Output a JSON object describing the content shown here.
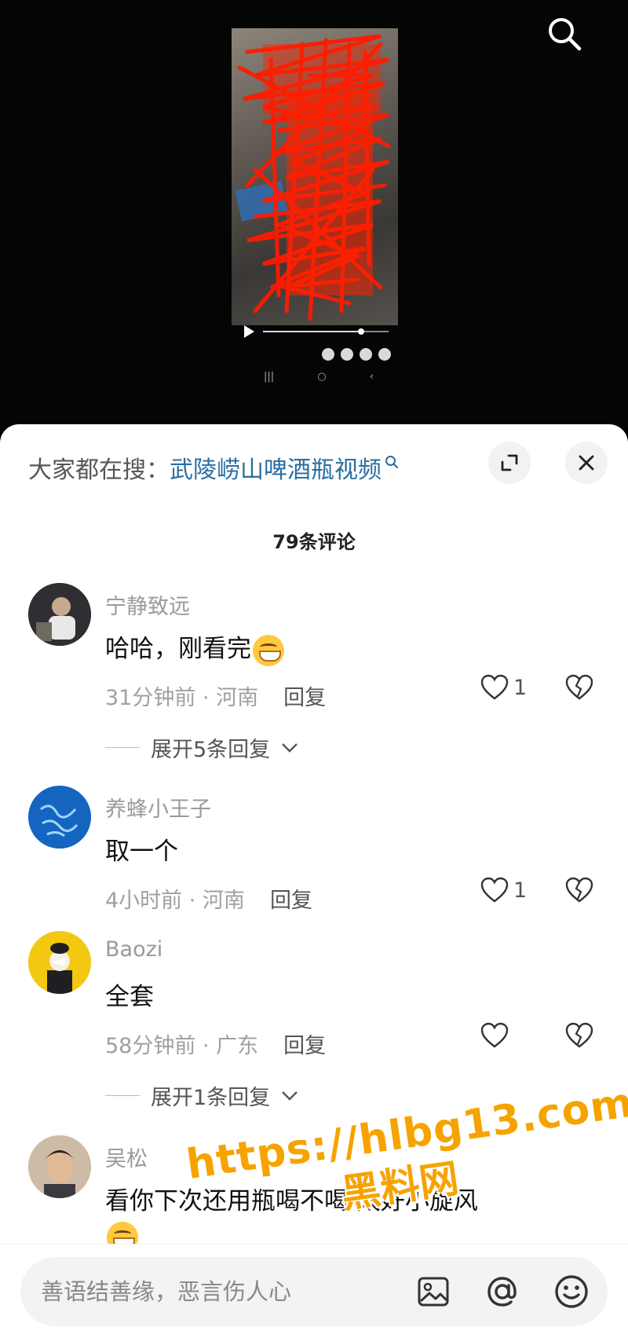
{
  "video": {
    "play_label": "",
    "timecode": "",
    "progress": 0.78
  },
  "search_suggest": {
    "prefix": "大家都在搜：",
    "topic": "武陵崂山啤酒瓶视频"
  },
  "comments_header": {
    "count_label": "79条评论"
  },
  "comments": [
    {
      "author": "宁静致远",
      "text": "哈哈，刚看完",
      "time_location": "31分钟前 · 河南",
      "reply_label": "回复",
      "likes": "1",
      "expand_label": "展开5条回复",
      "avatar_color": "#3b3a3f"
    },
    {
      "author": "养蜂小王子",
      "text": "取一个",
      "time_location": "4小时前 · 河南",
      "reply_label": "回复",
      "likes": "1",
      "avatar_color": "#1565c0"
    },
    {
      "author": "Baozi",
      "text": "全套",
      "time_location": "58分钟前 · 广东",
      "reply_label": "回复",
      "likes": "",
      "expand_label": "展开1条回复",
      "avatar_color": "#f2c811"
    },
    {
      "author": "吴松",
      "text": "看你下次还用瓶喝不喝 太好小旋风",
      "avatar_color": "#d9c4ae"
    }
  ],
  "watermark": {
    "url": "https://hlbg13.com",
    "name": "黑料网"
  },
  "input": {
    "placeholder": "善语结善缘，恶言伤人心"
  },
  "colors": {
    "accent_link": "#2a6ea0",
    "watermark": "#f6a300",
    "scribble": "#ff1a00"
  }
}
